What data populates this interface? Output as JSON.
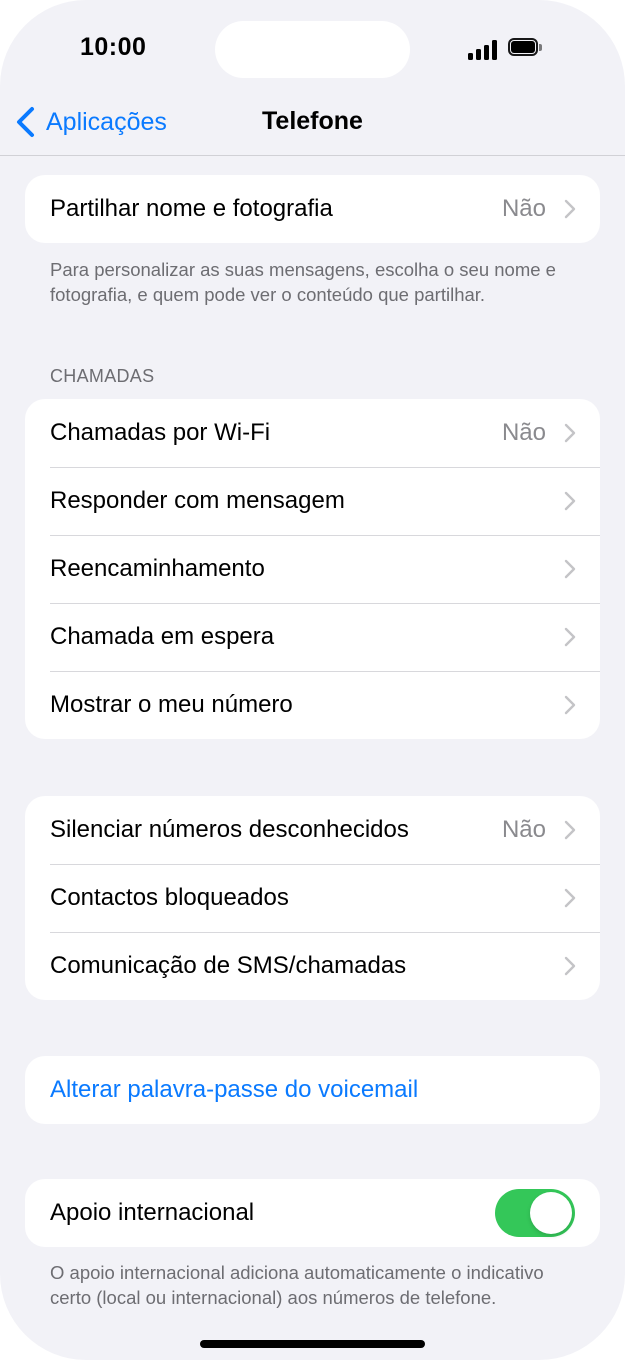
{
  "status_bar": {
    "time": "10:00",
    "icons": [
      "signal-icon",
      "battery-icon"
    ]
  },
  "nav": {
    "back_label": "Aplicações",
    "title": "Telefone"
  },
  "share_group": {
    "rows": [
      {
        "label": "Partilhar nome e fotografia",
        "value": "Não"
      }
    ],
    "footer": "Para personalizar as suas mensagens, escolha o seu nome e fotografia, e quem pode ver o conteúdo que partilhar."
  },
  "calls_group": {
    "header": "CHAMADAS",
    "rows": [
      {
        "label": "Chamadas por Wi-Fi",
        "value": "Não"
      },
      {
        "label": "Responder com mensagem",
        "value": ""
      },
      {
        "label": "Reencaminhamento",
        "value": ""
      },
      {
        "label": "Chamada em espera",
        "value": ""
      },
      {
        "label": "Mostrar o meu número",
        "value": ""
      }
    ]
  },
  "block_group": {
    "rows": [
      {
        "label": "Silenciar números desconhecidos",
        "value": "Não"
      },
      {
        "label": "Contactos bloqueados",
        "value": ""
      },
      {
        "label": "Comunicação de SMS/chamadas",
        "value": ""
      }
    ]
  },
  "voicemail_group": {
    "link_label": "Alterar palavra-passe do voicemail"
  },
  "intl_group": {
    "label": "Apoio internacional",
    "toggle_on": true,
    "footer": "O apoio internacional adiciona automaticamente o indicativo certo (local ou internacional) aos números de telefone."
  },
  "colors": {
    "accent": "#0a7aff",
    "toggle_on": "#34c759",
    "background": "#f2f2f7",
    "secondary_text": "#8a8a8e"
  }
}
